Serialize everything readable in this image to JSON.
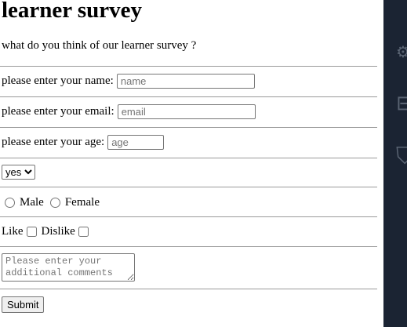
{
  "title": "learner survey",
  "subtitle": "what do you think of our learner survey ?",
  "name_field": {
    "label": "please enter your name:",
    "placeholder": "name"
  },
  "email_field": {
    "label": "please enter your email:",
    "placeholder": "email"
  },
  "age_field": {
    "label": "please enter your age:",
    "placeholder": "age"
  },
  "dropdown": {
    "selected": "yes"
  },
  "gender": {
    "male_label": "Male",
    "female_label": "Female"
  },
  "preference": {
    "like_label": "Like",
    "dislike_label": "Dislike"
  },
  "comments": {
    "placeholder": "Please enter your additional comments"
  },
  "submit_label": "Submit",
  "side_panel": {
    "background": "#1b2433",
    "icons": [
      "gear-icon",
      "window-icon",
      "shield-icon"
    ]
  }
}
